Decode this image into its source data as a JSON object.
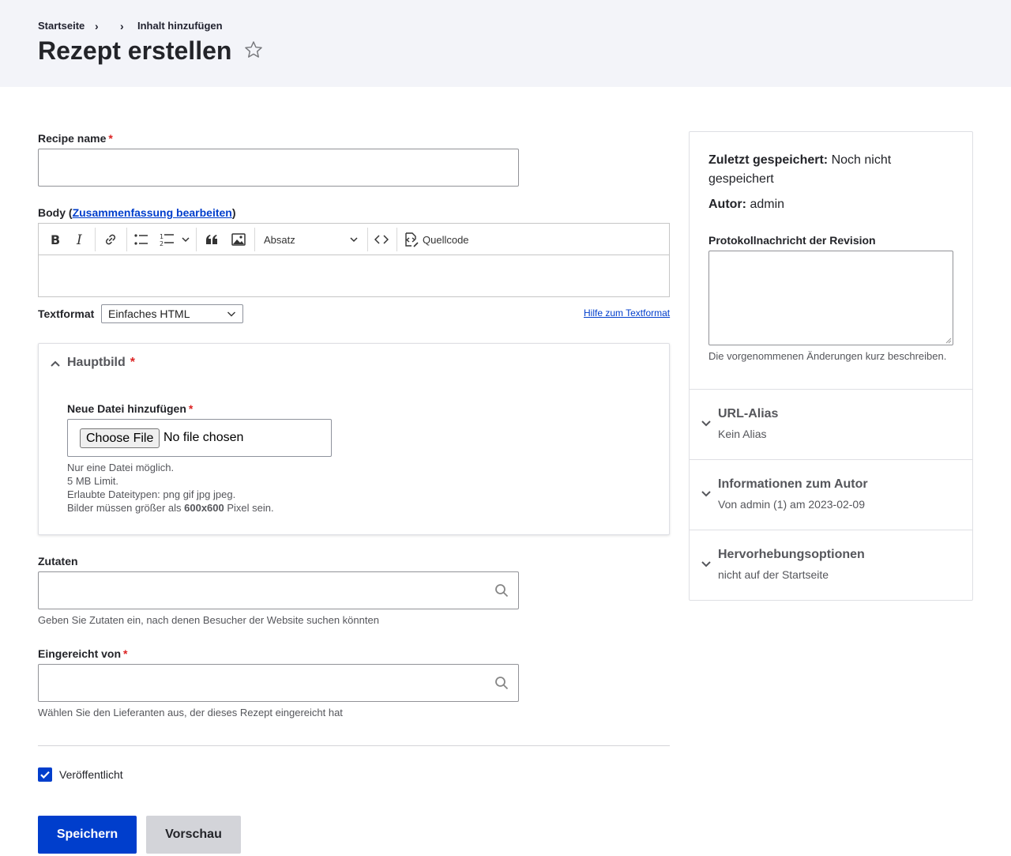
{
  "breadcrumb": {
    "home": "Startseite",
    "separator": "›",
    "add_content": "Inhalt hinzufügen"
  },
  "page": {
    "title": "Rezept erstellen",
    "star_icon": "star-outline-icon"
  },
  "recipe_name": {
    "label": "Recipe name",
    "required_mark": "*",
    "value": ""
  },
  "body": {
    "label_prefix": "Body (",
    "summary_link": "Zusammenfassung bearbeiten",
    "label_suffix": ")",
    "toolbar": {
      "bold_icon": "bold-icon",
      "italic_icon": "italic-icon",
      "link_icon": "link-icon",
      "bulleted_list_icon": "bulleted-list-icon",
      "numbered_list_icon": "numbered-list-icon",
      "blockquote_icon": "blockquote-icon",
      "image_icon": "image-icon",
      "heading_select": "Absatz",
      "code_icon": "code-icon",
      "source_label": "Quellcode"
    },
    "content": ""
  },
  "text_format": {
    "label": "Textformat",
    "selected": "Einfaches HTML",
    "help_link": "Hilfe zum Textformat"
  },
  "main_image": {
    "title": "Hauptbild",
    "required_mark": "*",
    "file_label": "Neue Datei hinzufügen",
    "choose_button": "Choose File",
    "no_file": "No file chosen",
    "desc_lines": [
      "Nur eine Datei möglich.",
      "5 MB Limit.",
      "Erlaubte Dateitypen: png gif jpg jpeg."
    ],
    "size_prefix": "Bilder müssen größer als ",
    "size_value": "600x600",
    "size_suffix": " Pixel sein."
  },
  "ingredients": {
    "label": "Zutaten",
    "value": "",
    "description": "Geben Sie Zutaten ein, nach denen Besucher der Website suchen könnten"
  },
  "submitted_by": {
    "label": "Eingereicht von",
    "required_mark": "*",
    "value": "",
    "description": "Wählen Sie den Lieferanten aus, der dieses Rezept eingereicht hat"
  },
  "published": {
    "label": "Veröffentlicht",
    "checked": true
  },
  "actions": {
    "save": "Speichern",
    "preview": "Vorschau"
  },
  "sidebar": {
    "last_saved_label": "Zuletzt gespeichert:",
    "last_saved_value": "Noch nicht gespeichert",
    "author_label": "Autor:",
    "author_value": "admin",
    "revision_label": "Protokollnachricht der Revision",
    "revision_value": "",
    "revision_desc": "Die vorgenommenen Änderungen kurz beschreiben.",
    "sections": [
      {
        "title": "URL-Alias",
        "subtitle": "Kein Alias"
      },
      {
        "title": "Informationen zum Autor",
        "subtitle": "Von admin (1) am 2023-02-09"
      },
      {
        "title": "Hervorhebungsoptionen",
        "subtitle": "nicht auf der Startseite"
      }
    ]
  },
  "colors": {
    "primary": "#003ecc",
    "required": "#dc2323",
    "header_bg": "#f3f4f9"
  }
}
